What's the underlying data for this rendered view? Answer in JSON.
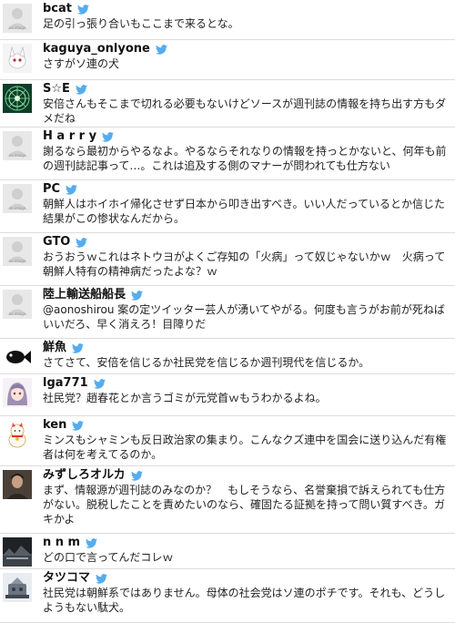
{
  "feed": {
    "tweets": [
      {
        "username": "bcat",
        "text": "足の引っ張り合いもここまで来るとな。",
        "avatar": "no-image-icon",
        "avatar_label": "no image"
      },
      {
        "username": "kaguya_onlyone",
        "text": "さすがソ連の犬",
        "avatar": "white-creature-icon"
      },
      {
        "username": "S☆E",
        "text": "安倍さんもそこまで切れる必要もないけどソースが週刊誌の情報を持ち出す方もダメだね",
        "avatar": "green-mandala-icon"
      },
      {
        "username": "H a r r y",
        "text": "謝るなら最初からやるなよ。やるならそれなりの情報を持っとかないと、何年も前の週刊誌記事って…。これは追及する側のマナーが問われても仕方ない",
        "avatar": "no-image-icon",
        "avatar_label": "no image"
      },
      {
        "username": "PC",
        "text": "朝鮮人はホイホイ帰化させず日本から叩き出すべき。いい人だっているとか信じた結果がこの惨状なんだから。",
        "avatar": "no-image-icon",
        "avatar_label": "no image"
      },
      {
        "username": "GTO",
        "text": "おうおうｗこれはネトウヨがよくご存知の「火病」って奴じゃないかｗ　火病って朝鮮人特有の精神病だったよな？ｗ",
        "avatar": "no-image-icon",
        "avatar_label": "no image"
      },
      {
        "username": "陸上輸送船船長",
        "text": "@aonoshirou 案の定ツイッター芸人が湧いてやがる。何度も言うがお前が死ねばいいだろ、早く消えろ！目障りだ",
        "avatar": "no-image-icon",
        "avatar_label": "no image"
      },
      {
        "username": "鮮魚",
        "text": "さてさて、安倍を信じるか社民党を信じるか週刊現代を信じるか。",
        "avatar": "fish-icon"
      },
      {
        "username": "lga771",
        "text": "社民党？趙春花とか言うゴミが元党首ｗもうわかるよね。",
        "avatar": "anime-girl-icon"
      },
      {
        "username": "ken",
        "text": "ミンスもシャミンも反日政治家の集まり。こんなクズ連中を国会に送り込んだ有権者は何を考えてるのか。",
        "avatar": "lucky-cat-icon"
      },
      {
        "username": "みずしろオルカ",
        "text": "まず、情報源が週刊誌のみなのか？　もしそうなら、名誉棄損で訴えられても仕方がない。脱税したことを責めたいのなら、確固たる証拠を持って問い質すべき。ガキかよ",
        "avatar": "person-photo-icon"
      },
      {
        "username": "n n m",
        "text": "どの口で言ってんだコレｗ",
        "avatar": "dark-landscape-icon"
      },
      {
        "username": "タツコマ",
        "text": "社民党は朝鮮系ではありません。母体の社会党はソ連のポチです。それも、どうしようもない駄犬。",
        "avatar": "robot-icon"
      }
    ]
  },
  "colors": {
    "twitter_bird": "#55acee",
    "divider": "#dcdcdc",
    "name_text": "#111111",
    "body_text": "#222222"
  }
}
